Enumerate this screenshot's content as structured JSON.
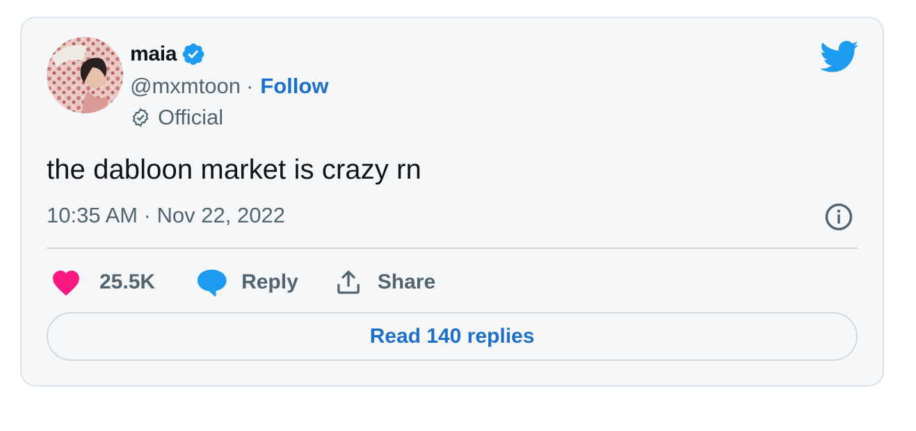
{
  "author": {
    "name": "maia",
    "handle": "@mxmtoon",
    "separator": "·",
    "follow_label": "Follow",
    "label": "Official",
    "verified": true
  },
  "tweet": {
    "text": "the dabloon market is crazy rn",
    "timestamp": "10:35 AM · Nov 22, 2022"
  },
  "actions": {
    "like_count": "25.5K",
    "reply_label": "Reply",
    "share_label": "Share"
  },
  "read_replies_label": "Read 140 replies",
  "icons": {
    "verified": "verified-badge-icon",
    "official": "official-badge-icon",
    "brand": "twitter-bird-icon",
    "info": "info-icon",
    "like": "heart-icon",
    "reply": "speech-bubble-icon",
    "share": "share-upload-icon"
  },
  "colors": {
    "card_background": "#f6f7f8",
    "link_blue": "#1d70c9",
    "twitter_blue": "#1d9bf0",
    "like_pink": "#f91880",
    "muted_text": "#536471"
  }
}
